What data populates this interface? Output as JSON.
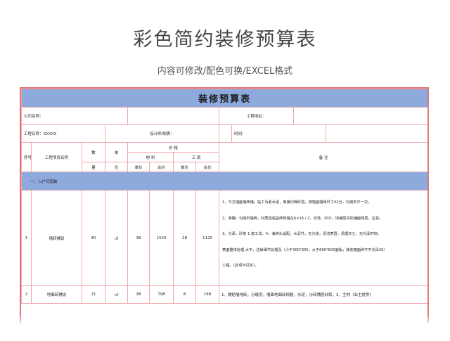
{
  "title": "彩色简约装修预算表",
  "subtitle": "内容可修改/配色可换/EXCEL格式",
  "sheet": {
    "heading": "装修预算表",
    "company_label": "公司名称：",
    "project_label": "工程地址：",
    "project_name_label": "工程名称：XXXXX",
    "designer_label": "设计师/制表：",
    "date_label": "时间：",
    "col_no": "序号",
    "col_item": "工程项目名称",
    "col_qty": "数",
    "col_unit": "单",
    "col_price": "价  格",
    "col_material": "材    料",
    "col_labor": "工    资",
    "col_notes": "备    注",
    "sub_qty": "量",
    "sub_unit": "位",
    "sub_mat_unit": "单价",
    "sub_mat_total": "合价",
    "sub_lab_unit": "单价",
    "sub_lab_total": "合价",
    "section_1": "一、入户花园装",
    "rows": [
      {
        "no": "1",
        "item": "墙砖铺设",
        "qty": "40",
        "unit": "㎡",
        "mat_unit": "38",
        "mat_total": "1520",
        "lab_unit": "28",
        "lab_total": "1120",
        "notes": [
          "1、平方墙面墙砖铺，贴工为素水泥，用量约两砂层，按墙面墙砖尺寸42分，勾缝剂平一次。",
          "2、准确：勾缝剂墙砖，材质选成品砖规格在6×16 / 2、光泽，中沙，地铺层并加铺面饰层，注意。",
          "3、光泽，砂浆 1 施工法，4、海绵头适配，水泥节，无污染，清洁表层，清理灰尘，无光泽时刻。",
          "表面整体处理 水平，边缘细节处理及（小于300*300，大于600*600面板，其他墙面砖平平光泽20）",
          "工程。（此项不打折）。"
        ]
      },
      {
        "no": "2",
        "item": "地面砖铺设",
        "qty": "21",
        "unit": "㎡",
        "mat_unit": "38",
        "mat_total": "798",
        "lab_unit": "8",
        "lab_total": "168",
        "notes": [
          "1、铺贴墙地砖，分缝剂，墙面地面砖规格，水泥，沙砖铺层砂浆，2、主材（业主提供）"
        ]
      }
    ]
  },
  "colors": {
    "header_fill": "#8ea9dc",
    "frame_border": "#e2747a",
    "grid_line": "#f1a7ab"
  }
}
